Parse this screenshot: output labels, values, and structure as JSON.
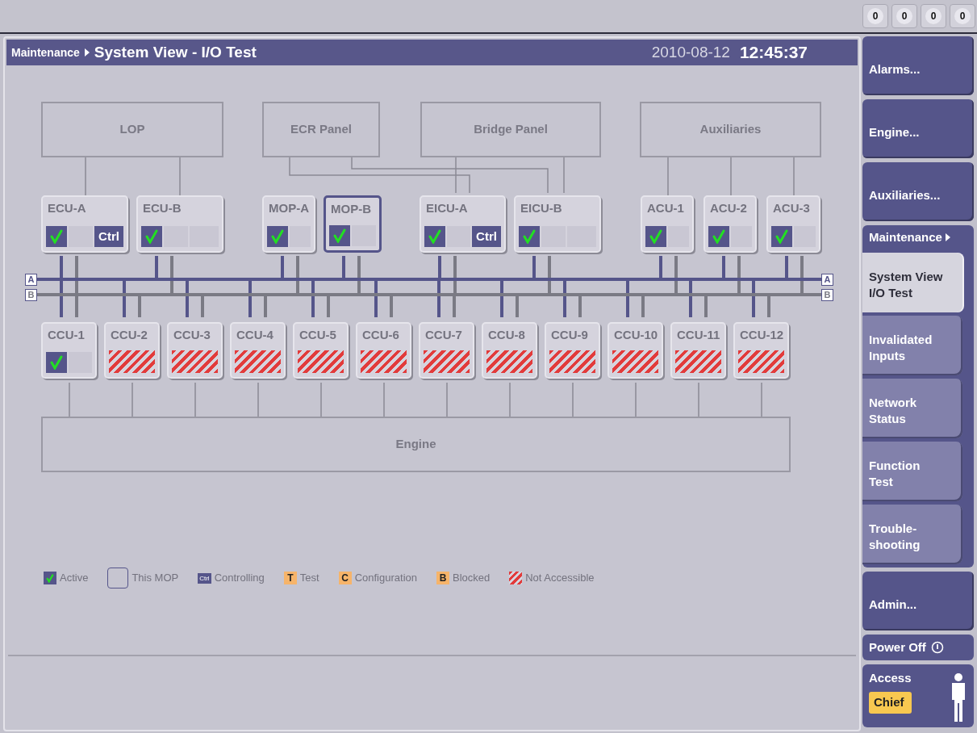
{
  "top_counters": [
    "0",
    "0",
    "0",
    "0"
  ],
  "header": {
    "breadcrumb": "Maintenance",
    "title": "System View - I/O Test",
    "date": "2010-08-12",
    "time": "12:45:37"
  },
  "panels": [
    {
      "label": "LOP"
    },
    {
      "label": "ECR Panel"
    },
    {
      "label": "Bridge Panel"
    },
    {
      "label": "Auxiliaries"
    }
  ],
  "units": [
    {
      "name": "ECU-A",
      "this_mop": false,
      "slots": [
        {
          "kind": "active"
        },
        {
          "kind": "empty"
        },
        {
          "kind": "ctrl",
          "text": "Ctrl"
        }
      ]
    },
    {
      "name": "ECU-B",
      "this_mop": false,
      "slots": [
        {
          "kind": "active"
        },
        {
          "kind": "empty"
        },
        {
          "kind": "empty"
        }
      ]
    },
    {
      "name": "MOP-A",
      "this_mop": false,
      "slots": [
        {
          "kind": "active"
        },
        {
          "kind": "empty"
        }
      ]
    },
    {
      "name": "MOP-B",
      "this_mop": true,
      "slots": [
        {
          "kind": "active"
        },
        {
          "kind": "empty"
        }
      ]
    },
    {
      "name": "EICU-A",
      "this_mop": false,
      "slots": [
        {
          "kind": "active"
        },
        {
          "kind": "empty"
        },
        {
          "kind": "ctrl",
          "text": "Ctrl"
        }
      ]
    },
    {
      "name": "EICU-B",
      "this_mop": false,
      "slots": [
        {
          "kind": "active"
        },
        {
          "kind": "empty"
        },
        {
          "kind": "empty"
        }
      ]
    },
    {
      "name": "ACU-1",
      "this_mop": false,
      "slots": [
        {
          "kind": "active"
        },
        {
          "kind": "empty"
        }
      ]
    },
    {
      "name": "ACU-2",
      "this_mop": false,
      "slots": [
        {
          "kind": "active"
        },
        {
          "kind": "empty"
        }
      ]
    },
    {
      "name": "ACU-3",
      "this_mop": false,
      "slots": [
        {
          "kind": "active"
        },
        {
          "kind": "empty"
        }
      ]
    }
  ],
  "buses": [
    {
      "left_label": "A",
      "right_label": "A"
    },
    {
      "left_label": "B",
      "right_label": "B"
    }
  ],
  "ccus": [
    {
      "name": "CCU-1",
      "slots": [
        {
          "kind": "active"
        },
        {
          "kind": "empty"
        }
      ]
    },
    {
      "name": "CCU-2",
      "slots": [
        {
          "kind": "not_accessible"
        }
      ]
    },
    {
      "name": "CCU-3",
      "slots": [
        {
          "kind": "not_accessible"
        }
      ]
    },
    {
      "name": "CCU-4",
      "slots": [
        {
          "kind": "not_accessible"
        }
      ]
    },
    {
      "name": "CCU-5",
      "slots": [
        {
          "kind": "not_accessible"
        }
      ]
    },
    {
      "name": "CCU-6",
      "slots": [
        {
          "kind": "not_accessible"
        }
      ]
    },
    {
      "name": "CCU-7",
      "slots": [
        {
          "kind": "not_accessible"
        }
      ]
    },
    {
      "name": "CCU-8",
      "slots": [
        {
          "kind": "not_accessible"
        }
      ]
    },
    {
      "name": "CCU-9",
      "slots": [
        {
          "kind": "not_accessible"
        }
      ]
    },
    {
      "name": "CCU-10",
      "slots": [
        {
          "kind": "not_accessible"
        }
      ]
    },
    {
      "name": "CCU-11",
      "slots": [
        {
          "kind": "not_accessible"
        }
      ]
    },
    {
      "name": "CCU-12",
      "slots": [
        {
          "kind": "not_accessible"
        }
      ]
    }
  ],
  "engine": {
    "label": "Engine"
  },
  "legend": [
    {
      "kind": "active",
      "label": "Active"
    },
    {
      "kind": "this_mop",
      "label": "This MOP"
    },
    {
      "kind": "ctrl",
      "icon_text": "Ctrl",
      "label": "Controlling"
    },
    {
      "kind": "letter",
      "icon_text": "T",
      "label": "Test"
    },
    {
      "kind": "letter",
      "icon_text": "C",
      "label": "Configuration"
    },
    {
      "kind": "letter",
      "icon_text": "B",
      "label": "Blocked"
    },
    {
      "kind": "not_accessible",
      "label": "Not Accessible"
    }
  ],
  "sidebar": {
    "top_buttons": [
      {
        "label": "Alarms..."
      },
      {
        "label": "Engine..."
      },
      {
        "label": "Auxiliaries..."
      }
    ],
    "group": {
      "label": "Maintenance",
      "items": [
        {
          "label": "System View\nI/O Test",
          "selected": true
        },
        {
          "label": "Invalidated\nInputs",
          "selected": false
        },
        {
          "label": "Network\nStatus",
          "selected": false
        },
        {
          "label": "Function\nTest",
          "selected": false
        },
        {
          "label": "Trouble-\nshooting",
          "selected": false
        }
      ]
    },
    "bottom_buttons": [
      {
        "label": "Admin..."
      }
    ],
    "power": {
      "label": "Power Off"
    },
    "access": {
      "label": "Access",
      "level": "Chief"
    }
  }
}
